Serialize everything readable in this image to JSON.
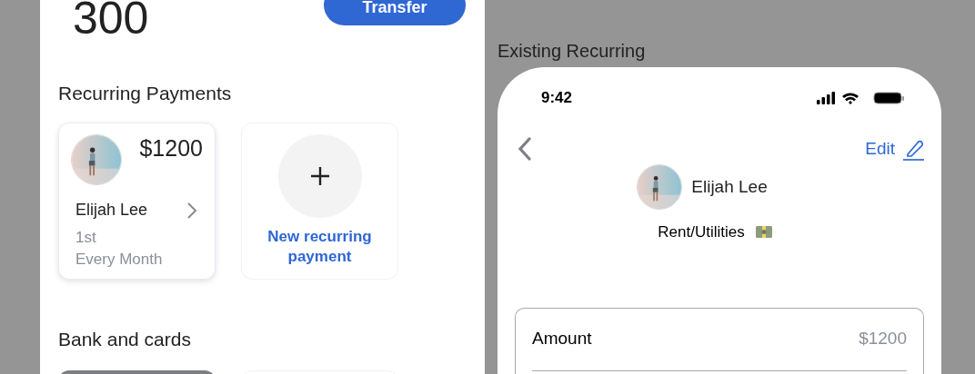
{
  "balance": "300",
  "transfer_button": "Transfer",
  "recurring_section": {
    "title": "Recurring Payments",
    "payments": [
      {
        "name": "Elijah Lee",
        "amount": "$1200",
        "day": "1st",
        "frequency": "Every Month"
      }
    ],
    "new_button": "New recurring payment"
  },
  "bank_section": {
    "title": "Bank and cards"
  },
  "detail_title": "Existing Recurring",
  "phone": {
    "time": "9:42",
    "edit": "Edit",
    "name": "Elijah Lee",
    "category": "Rent/Utilities",
    "fields": [
      {
        "label": "Amount",
        "value": "$1200"
      }
    ]
  }
}
